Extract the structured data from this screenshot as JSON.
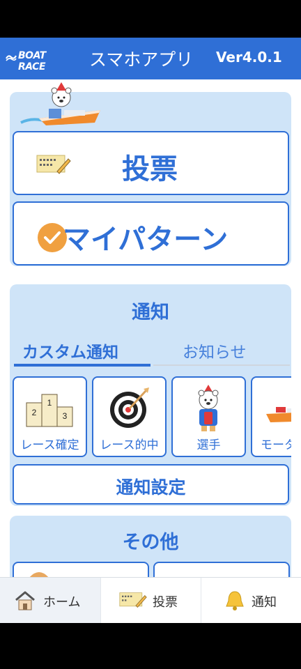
{
  "header": {
    "brand": "BOAT RACE",
    "title": "スマホアプリ",
    "version": "Ver4.0.1"
  },
  "main": {
    "vote_label": "投票",
    "pattern_label": "マイパターン"
  },
  "notice": {
    "title": "通知",
    "tabs": [
      {
        "label": "カスタム通知",
        "active": true
      },
      {
        "label": "お知らせ",
        "active": false
      }
    ],
    "tiles": [
      {
        "label": "レース確定",
        "icon": "podium-icon"
      },
      {
        "label": "レース的中",
        "icon": "target-icon"
      },
      {
        "label": "選手",
        "icon": "racer-bear-icon"
      },
      {
        "label": "モーター",
        "icon": "boat-icon"
      }
    ],
    "podium_numbers": [
      "2",
      "1",
      "3"
    ],
    "settings_label": "通知設定"
  },
  "other": {
    "title": "その他"
  },
  "bottom_nav": {
    "items": [
      {
        "label": "ホーム",
        "icon": "home-icon",
        "active": true
      },
      {
        "label": "投票",
        "icon": "ticket-icon",
        "active": false
      },
      {
        "label": "通知",
        "icon": "bell-icon",
        "active": false
      }
    ]
  },
  "colors": {
    "brand_blue": "#2f6fd6",
    "panel_bg": "#cfe4f8",
    "check_orange": "#f0a040"
  }
}
